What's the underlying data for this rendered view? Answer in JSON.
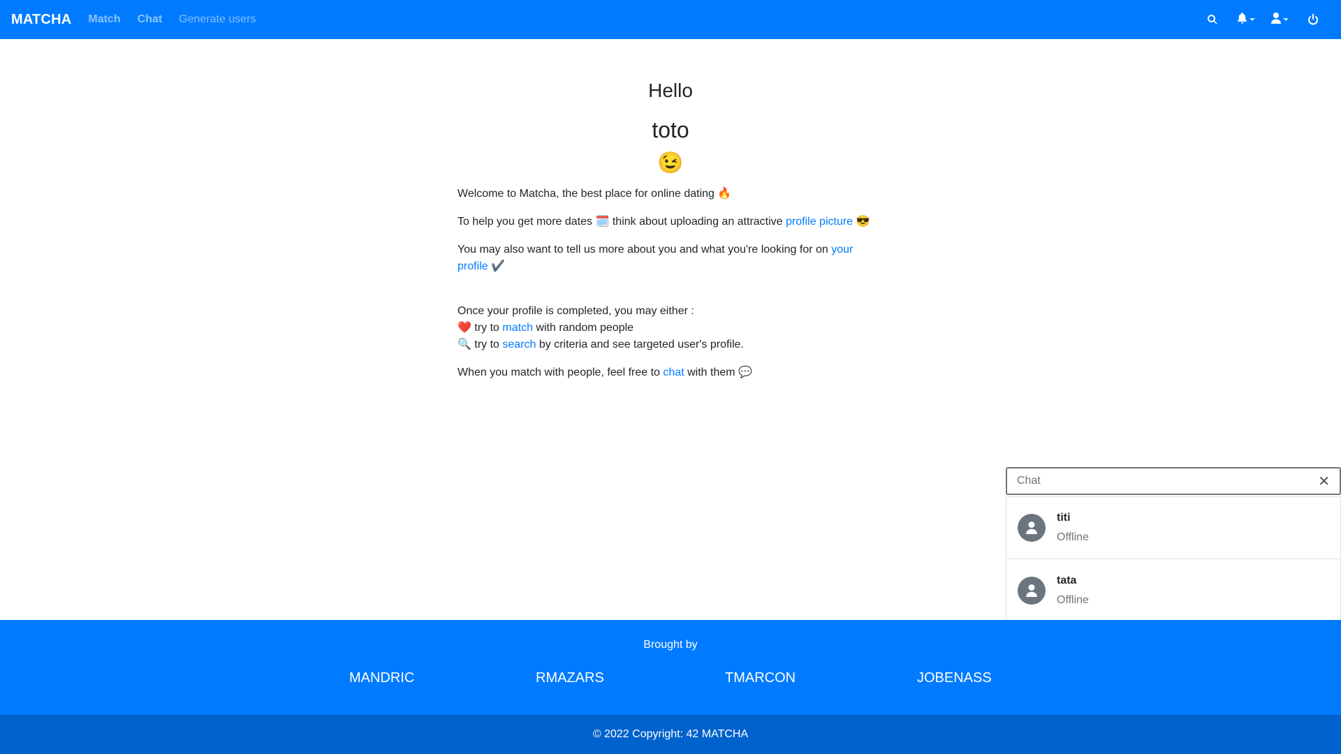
{
  "navbar": {
    "brand": "MATCHA",
    "links": [
      "Match",
      "Chat",
      "Generate users"
    ],
    "icons": [
      "search-icon",
      "bell-icon",
      "user-icon",
      "power-icon"
    ]
  },
  "main": {
    "greeting": "Hello",
    "username": "toto",
    "wink_emoji": "😉",
    "welcome": "Welcome to Matcha, the best place for online dating",
    "fire_emoji": "🔥",
    "dates_prefix": "To help you get more dates",
    "calendar_emoji": "🗓️",
    "dates_middle": "think about uploading an attractive",
    "profile_picture_link": "profile picture",
    "sunglasses_emoji": "😎",
    "profile_prefix": "You may also want to tell us more about you and what you're looking for on",
    "your_profile_link": "your profile",
    "check_emoji": "✔️",
    "completed_text": "Once your profile is completed, you may either :",
    "heart_emoji": "❤️",
    "try_to": "try to",
    "match_link": "match",
    "match_suffix": "with random people",
    "magnifier_emoji": "🔍",
    "search_link": "search",
    "search_suffix": "by criteria and see targeted user's profile.",
    "chat_prefix": "When you match with people, feel free to",
    "chat_link": "chat",
    "chat_suffix": "with them",
    "speech_emoji": "💬"
  },
  "chat": {
    "title": "Chat",
    "close": "✕",
    "users": [
      {
        "name": "titi",
        "status": "Offline"
      },
      {
        "name": "tata",
        "status": "Offline"
      }
    ]
  },
  "footer": {
    "brought_by": "Brought by",
    "authors": [
      "MANDRIC",
      "RMAZARS",
      "TMARCON",
      "JOBENASS"
    ],
    "copyright": "© 2022 Copyright: 42 MATCHA"
  },
  "colors": {
    "primary": "#007bff",
    "footer_dark": "#0062cc",
    "avatar_gray": "#6c757d"
  }
}
